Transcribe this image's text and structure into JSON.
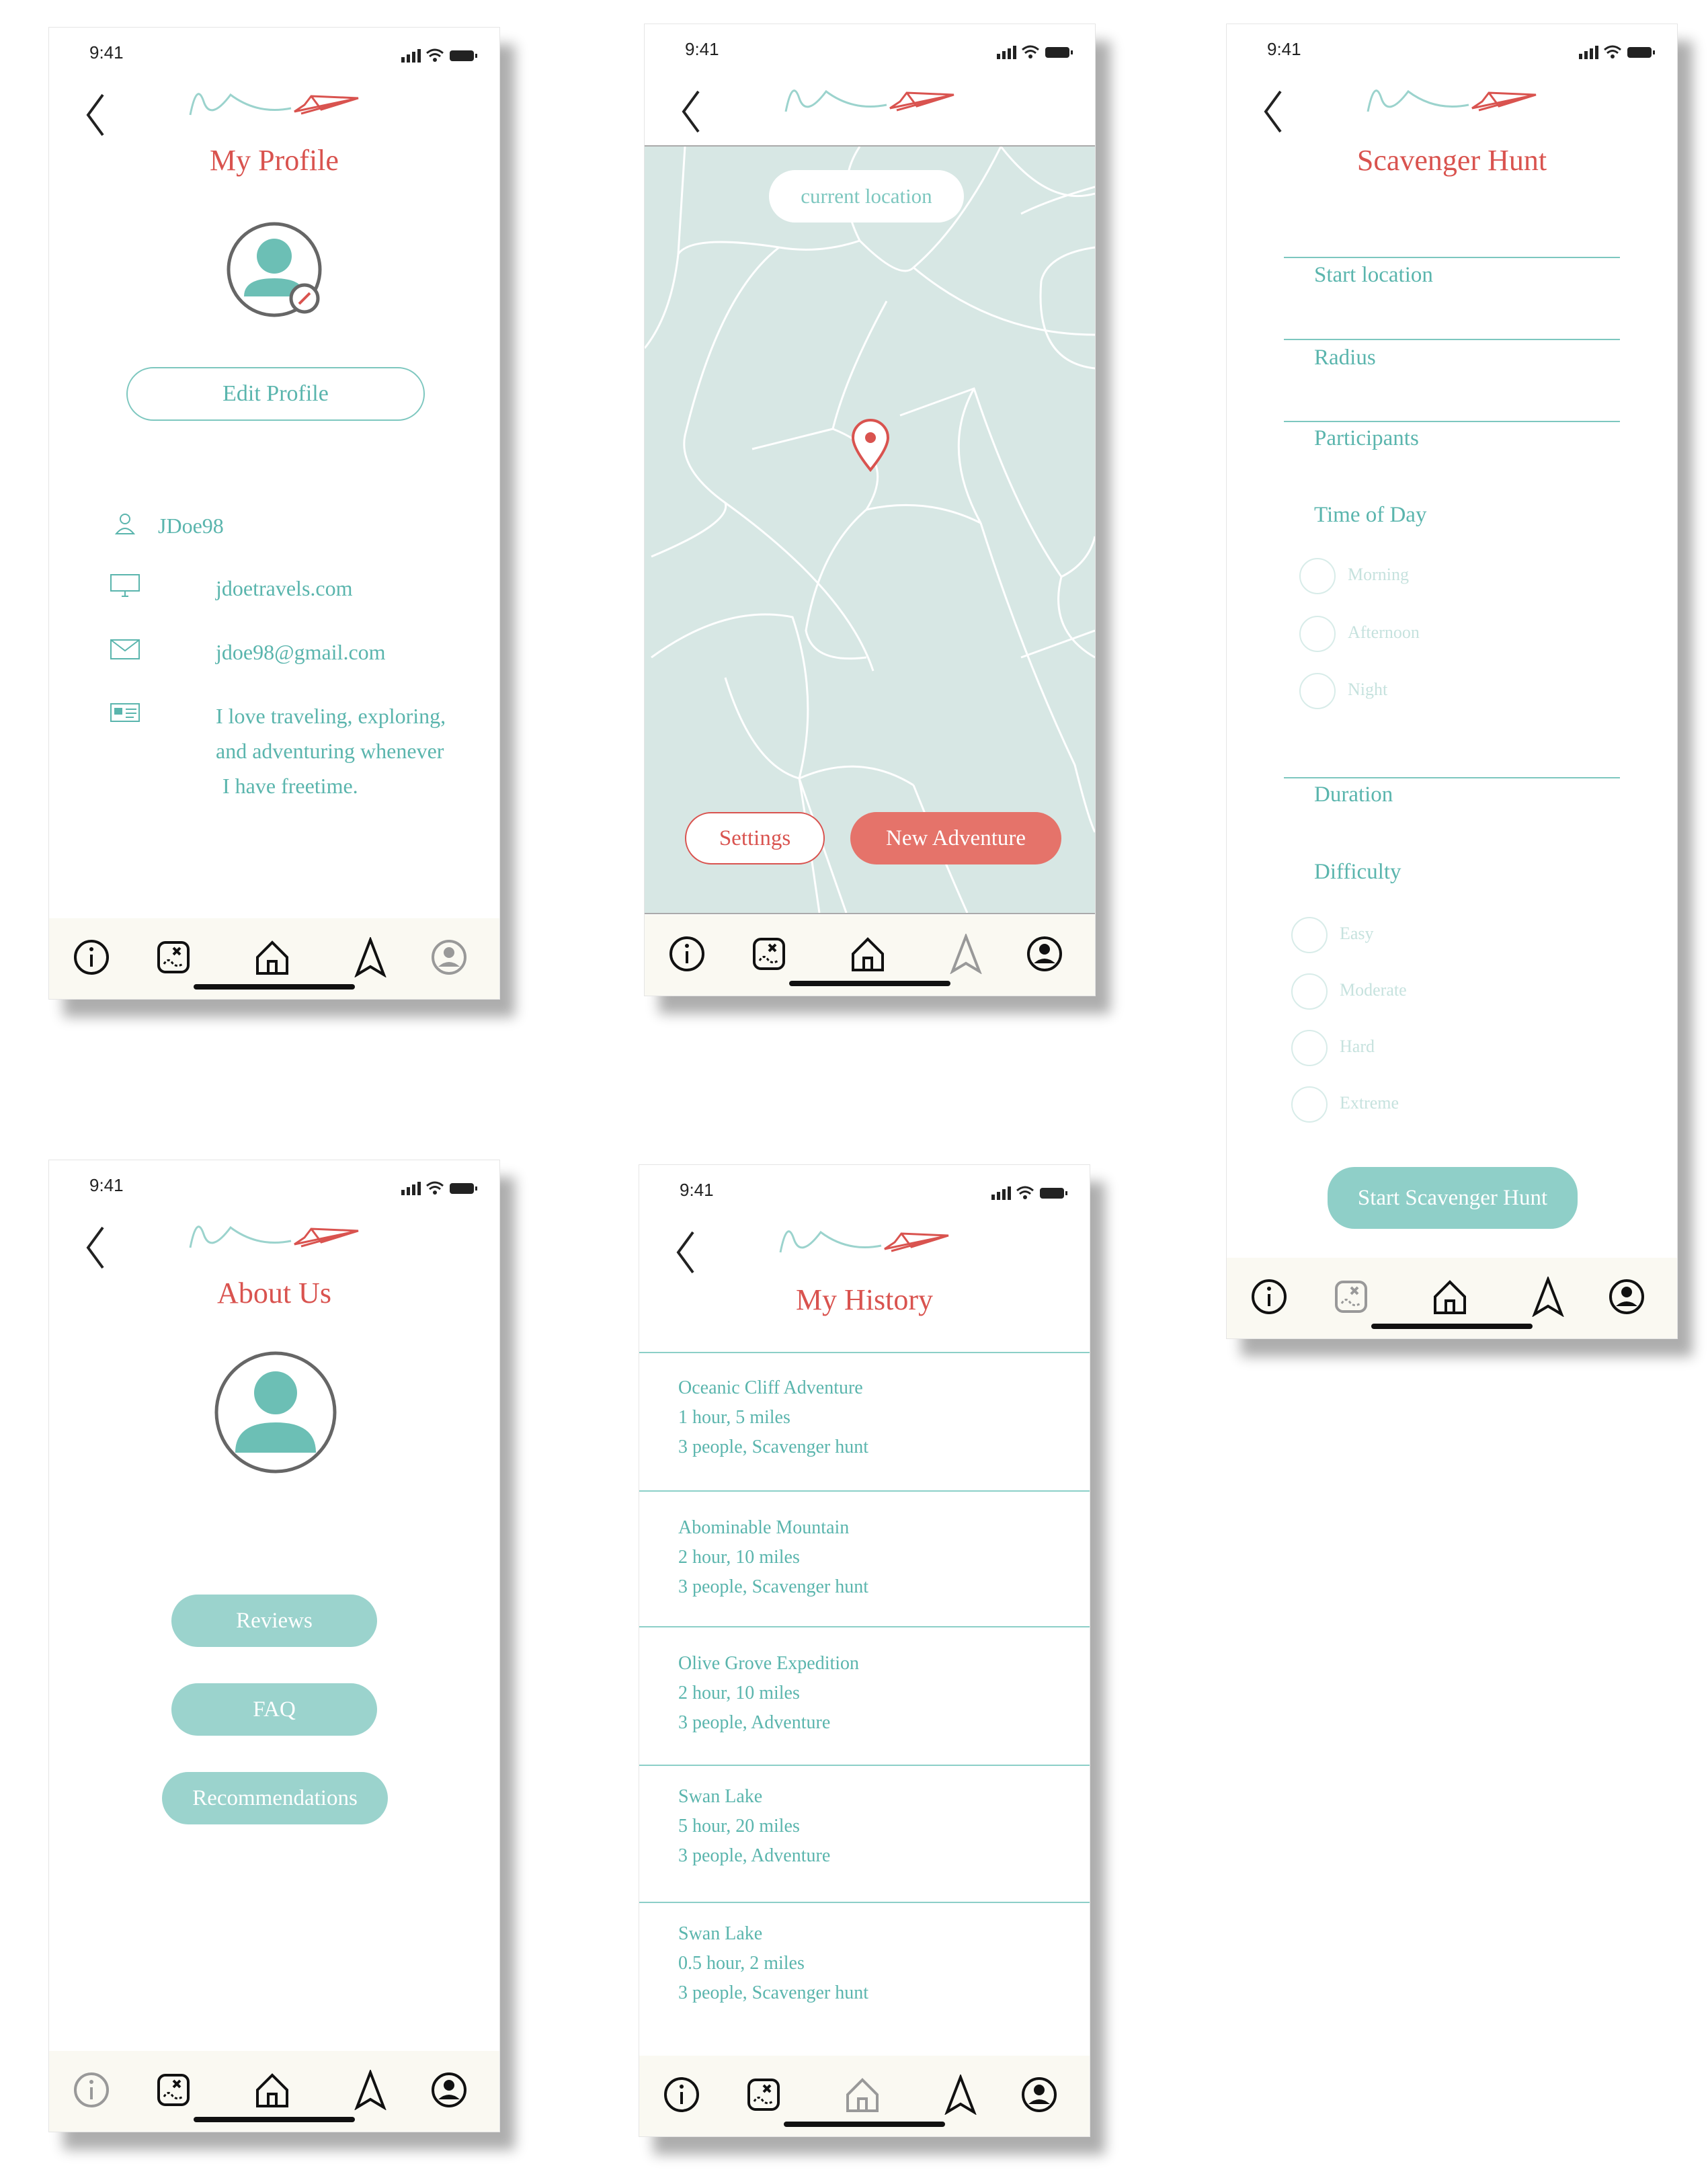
{
  "status": {
    "time": "9:41"
  },
  "profile": {
    "title": "My Profile",
    "edit_label": "Edit Profile",
    "username": "JDoe98",
    "website": "jdoetravels.com",
    "email": "jdoe98@gmail.com",
    "bio_1": "I love traveling, exploring,",
    "bio_2": "and adventuring whenever",
    "bio_3": "I have freetime."
  },
  "map": {
    "search_placeholder": "current location",
    "settings_label": "Settings",
    "new_adventure_label": "New Adventure"
  },
  "scavenger": {
    "title": "Scavenger Hunt",
    "start_location": "Start location",
    "radius": "Radius",
    "participants": "Participants",
    "time_of_day": "Time of Day",
    "time_options": [
      "Morning",
      "Afternoon",
      "Night"
    ],
    "duration": "Duration",
    "difficulty": "Difficulty",
    "difficulty_options": [
      "Easy",
      "Moderate",
      "Hard",
      "Extreme"
    ],
    "start_button": "Start Scavenger Hunt"
  },
  "about": {
    "title": "About Us",
    "reviews": "Reviews",
    "faq": "FAQ",
    "recommendations": "Recommendations"
  },
  "history": {
    "title": "My History",
    "items": [
      {
        "name": "Oceanic Cliff Adventure",
        "duration": "1 hour, 5 miles",
        "detail": "3 people, Scavenger hunt"
      },
      {
        "name": "Abominable Mountain",
        "duration": "2 hour, 10 miles",
        "detail": "3 people, Scavenger hunt"
      },
      {
        "name": "Olive Grove Expedition",
        "duration": "2 hour, 10 miles",
        "detail": "3 people, Adventure"
      },
      {
        "name": "Swan Lake",
        "duration": "5 hour, 20 miles",
        "detail": "3 people, Adventure"
      },
      {
        "name": "Swan Lake",
        "duration": "0.5 hour, 2 miles",
        "detail": "3 people, Scavenger hunt"
      }
    ]
  },
  "colors": {
    "accent_red": "#d9534f",
    "teal": "#5ab5ad",
    "map_bg": "#d7e7e4",
    "nav_bg": "#faf9f2"
  }
}
